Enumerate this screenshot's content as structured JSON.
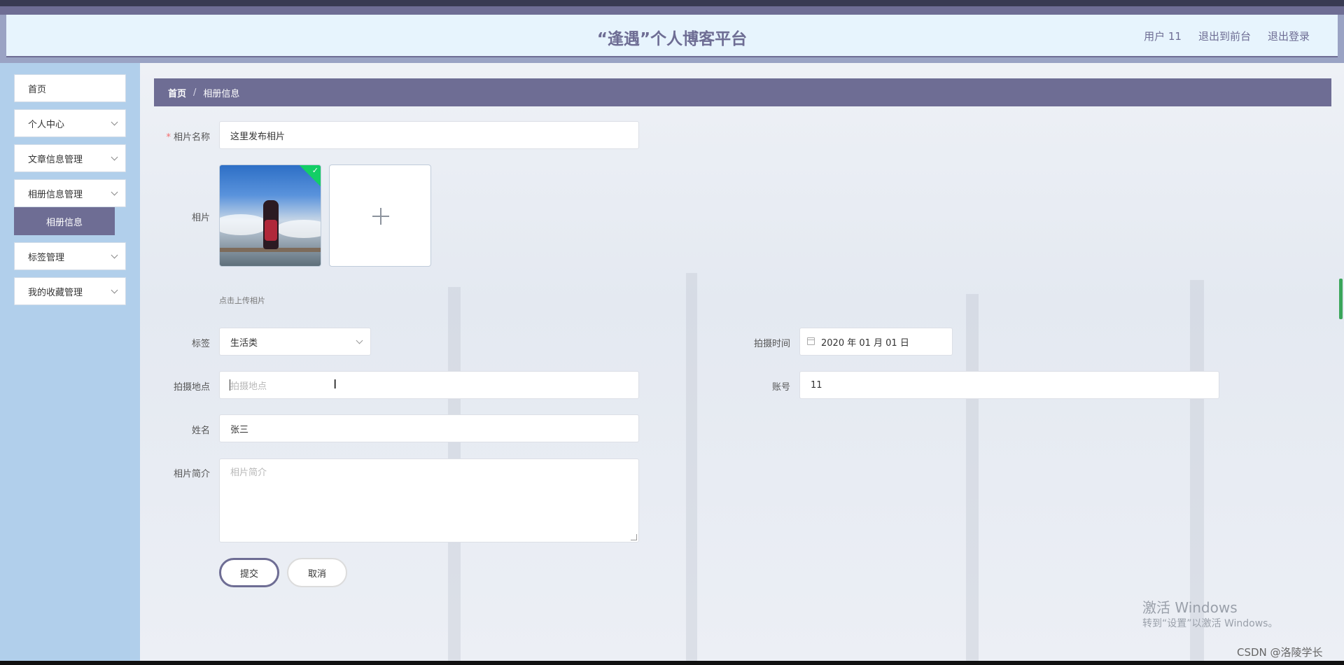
{
  "header": {
    "title": "“逢遇”个人博客平台",
    "user_label": "用户 11",
    "back_to_front": "退出到前台",
    "logout": "退出登录"
  },
  "sidebar": {
    "items": [
      {
        "label": "首页"
      },
      {
        "label": "个人中心"
      },
      {
        "label": "文章信息管理"
      },
      {
        "label": "相册信息管理"
      },
      {
        "label": "标签管理"
      },
      {
        "label": "我的收藏管理"
      }
    ],
    "active_submenu": "相册信息"
  },
  "breadcrumb": {
    "home": "首页",
    "separator": "/",
    "current": "相册信息"
  },
  "form": {
    "photo_name": {
      "label": "相片名称",
      "required_mark": "*",
      "value": "这里发布相片"
    },
    "photo": {
      "label": "相片",
      "hint": "点击上传相片",
      "plus": "+"
    },
    "tag": {
      "label": "标签",
      "value": "生活类"
    },
    "shoot_time": {
      "label": "拍摄时间",
      "value": "2020 年 01 月 01 日"
    },
    "location": {
      "label": "拍摄地点",
      "placeholder": "拍摄地点"
    },
    "account": {
      "label": "账号",
      "value": "11"
    },
    "name": {
      "label": "姓名",
      "value": "张三"
    },
    "intro": {
      "label": "相片简介",
      "placeholder": "相片简介"
    },
    "submit": "提交",
    "cancel": "取消"
  },
  "overlay": {
    "activate_title": "激活 Windows",
    "activate_sub": "转到“设置”以激活 Windows。",
    "csdn": "CSDN @洛陵学长"
  }
}
